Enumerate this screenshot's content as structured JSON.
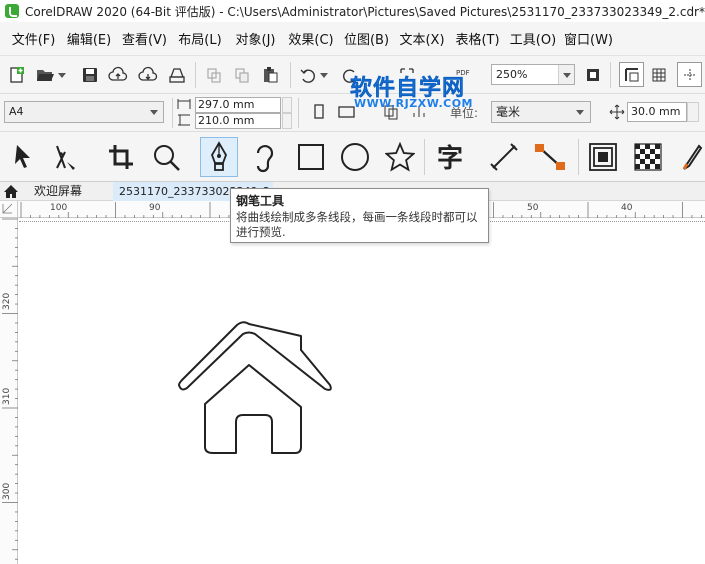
{
  "window": {
    "title": "CorelDRAW 2020 (64-Bit 评估版) - C:\\Users\\Administrator\\Pictures\\Saved Pictures\\2531170_233733023349_2.cdr*"
  },
  "menu": [
    "文件(F)",
    "编辑(E)",
    "查看(V)",
    "布局(L)",
    "对象(J)",
    "效果(C)",
    "位图(B)",
    "文本(X)",
    "表格(T)",
    "工具(O)",
    "窗口(W)"
  ],
  "toolbar": {
    "zoom": "250%"
  },
  "property_bar": {
    "page_size": "A4",
    "width": "297.0 mm",
    "height": "210.0 mm",
    "units_label": "单位:",
    "units": "毫米",
    "nudge": "30.0 mm"
  },
  "watermark": {
    "title": "软件自学网",
    "url": "WWW.RJZXW.COM"
  },
  "toolbox": {
    "active_tool": "pen-tool"
  },
  "tabs": {
    "welcome": "欢迎屏幕",
    "document": "2531170_233733023349_2.cdr"
  },
  "ruler": {
    "h_labels": [
      "100",
      "90",
      "50",
      "40"
    ],
    "v_labels": [
      "320",
      "310",
      "300"
    ]
  },
  "tooltip": {
    "title": "钢笔工具",
    "description": "将曲线绘制成多条线段，每画一条线段时都可以进行预览."
  },
  "colors": {
    "watermark": "#1f7fe8",
    "app_logo": "#3aa935",
    "active_tool_bg": "#dfeefb",
    "accent_orange": "#e06b1a"
  }
}
